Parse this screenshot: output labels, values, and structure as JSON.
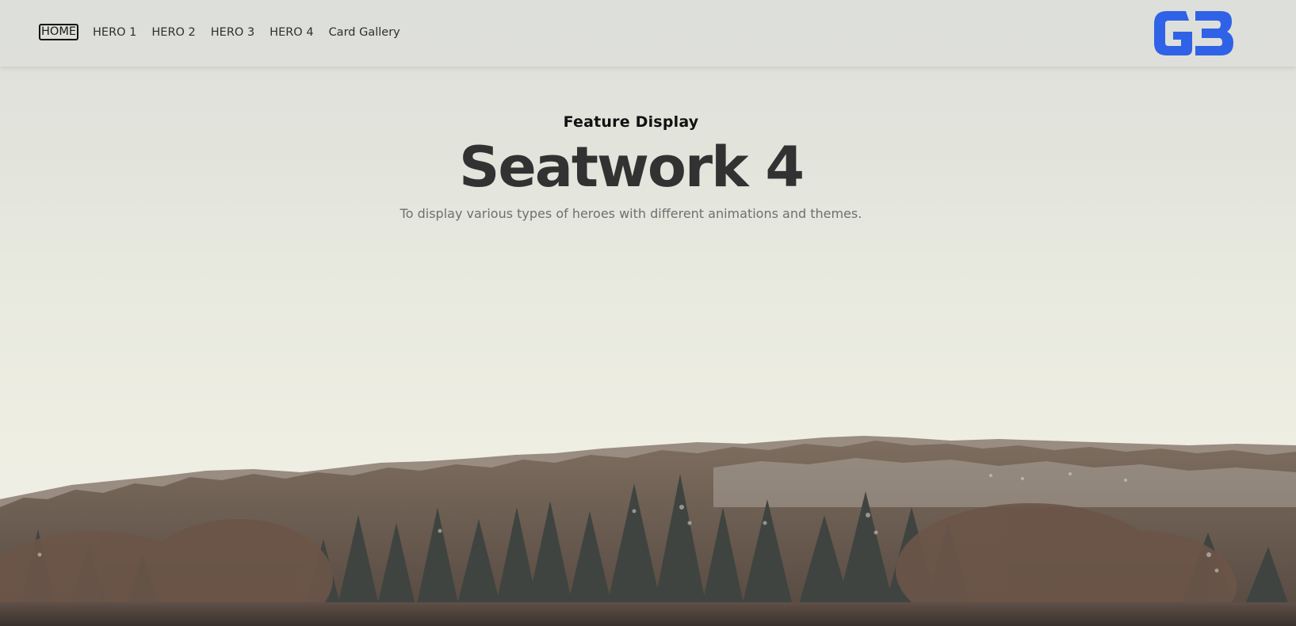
{
  "nav": {
    "items": [
      {
        "label": "HOME",
        "active": true
      },
      {
        "label": "HERO 1",
        "active": false
      },
      {
        "label": "HERO 2",
        "active": false
      },
      {
        "label": "HERO 3",
        "active": false
      },
      {
        "label": "HERO 4",
        "active": false
      },
      {
        "label": "Card Gallery",
        "active": false
      }
    ]
  },
  "logo": {
    "text": "GB",
    "color": "#2f62e6"
  },
  "hero": {
    "kicker": "Feature Display",
    "title": "Seatwork 4",
    "subtitle": "To display various types of heroes with different animations and themes."
  },
  "colors": {
    "sky": "#e6e8e0",
    "title": "#323232",
    "subtitle": "#6f6f6f",
    "accent": "#2f62e6"
  }
}
